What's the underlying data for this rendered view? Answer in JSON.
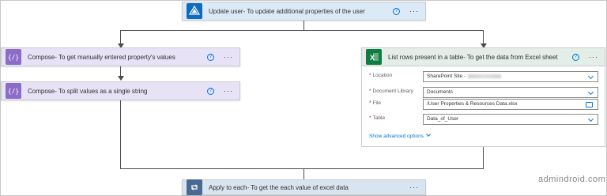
{
  "flow": {
    "update_user": {
      "title": "Update user- To update additional properties of the user",
      "icon": "azure-ad-icon",
      "color": "#dceaf7"
    },
    "compose1": {
      "title": "Compose- To get manually entered property's values",
      "icon": "compose-icon",
      "color": "#e7e2f5"
    },
    "compose2": {
      "title": "Compose- To split values as a single string",
      "icon": "compose-icon",
      "color": "#e7e2f5"
    },
    "list_rows": {
      "title": "List rows present in a table- To get the data from Excel sheet",
      "icon": "excel-icon",
      "color": "#e3eee8",
      "fields": [
        {
          "label": "Location",
          "value": "SharePoint Site -"
        },
        {
          "label": "Document Library",
          "value": "Documents"
        },
        {
          "label": "File",
          "value": "/User Properties & Resources Data.xlsx"
        },
        {
          "label": "Table",
          "value": "Data_of_User"
        }
      ],
      "show_advanced": "Show advanced options"
    },
    "apply_each": {
      "title": "Apply to each- To get the each value of excel data",
      "icon": "loop-icon",
      "color": "#d8e4ef"
    }
  },
  "help_glyph": "?",
  "more_glyph": "···",
  "brand": "admindroid.com"
}
